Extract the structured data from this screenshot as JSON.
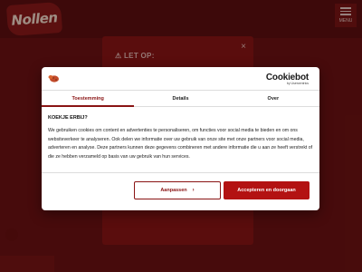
{
  "site": {
    "logo_text": "Nollen",
    "menu_label": "MENU",
    "notice_title": "LET OP:",
    "notice_close": "×"
  },
  "cookie_dialog": {
    "brand": "Cookiebot",
    "brand_sub": "by Usercentrics",
    "tabs": [
      {
        "label": "Toestemming",
        "active": true
      },
      {
        "label": "Details",
        "active": false
      },
      {
        "label": "Over",
        "active": false
      }
    ],
    "heading": "KOEKJE ERBIJ?",
    "text": "We gebruiken cookies om content en advertenties te personaliseren, om functies voor social media te bieden en om ons websiteverkeer te analyseren. Ook delen we informatie over uw gebruik van onze site met onze partners voor social media, adverteren en analyse. Deze partners kunnen deze gegevens combineren met andere informatie die u aan ze heeft verstrekt of die ze hebben verzameld op basis van uw gebruik van hun services.",
    "customize_label": "Aanpassen",
    "accept_label": "Accepteren en doorgaan",
    "accent_color": "#b31212"
  }
}
